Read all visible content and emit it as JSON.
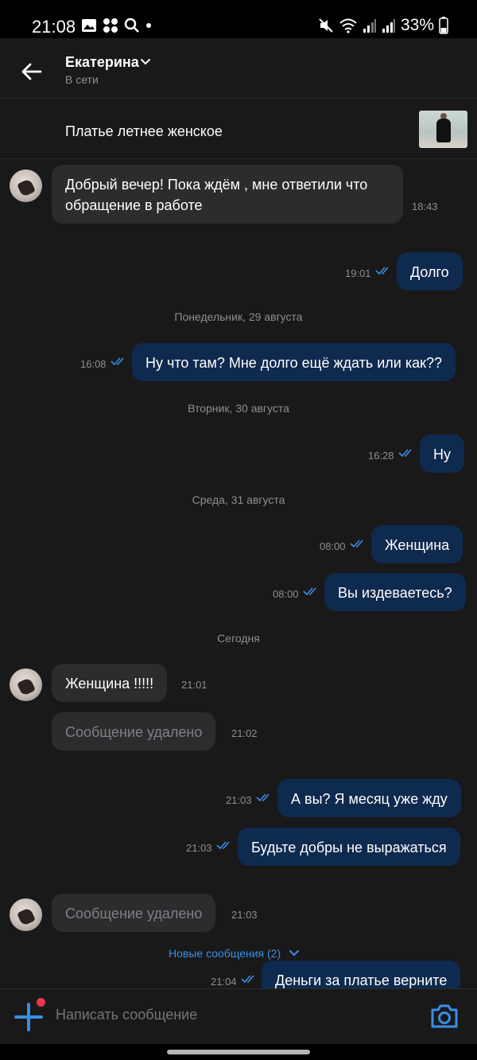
{
  "status_bar": {
    "time": "21:08",
    "battery": "33%",
    "icons_left": [
      "gallery-icon",
      "apps-icon",
      "search-icon",
      "dot-icon"
    ],
    "icons_right": [
      "mute-icon",
      "wifi-icon",
      "signal-icon",
      "signal-icon",
      "battery-icon"
    ]
  },
  "header": {
    "name": "Екатерина",
    "status": "В сети"
  },
  "product": {
    "title": "Платье летнее женское"
  },
  "messages": [
    {
      "dir": "in",
      "lines": [
        "Добрый вечер! Пока ждём , мне ответили что",
        "обращение в работе"
      ],
      "time": "18:43"
    },
    {
      "dir": "out",
      "text": "Долго",
      "time": "19:01"
    },
    {
      "separator": "Понедельник, 29 августа"
    },
    {
      "dir": "out",
      "text": "Ну что там? Мне долго ещё ждать или как??",
      "time": "16:08"
    },
    {
      "separator": "Вторник, 30 августа"
    },
    {
      "dir": "out",
      "text": "Ну",
      "time": "16:28"
    },
    {
      "separator": "Среда, 31 августа"
    },
    {
      "dir": "out",
      "text": "Женщина",
      "time": "08:00"
    },
    {
      "dir": "out",
      "text": "Вы издеваетесь?",
      "time": "08:00"
    },
    {
      "separator": "Сегодня"
    },
    {
      "dir": "in",
      "text": "Женщина !!!!!",
      "time": "21:01"
    },
    {
      "dir": "in",
      "deleted": true,
      "text": "Сообщение удалено",
      "time": "21:02"
    },
    {
      "dir": "out",
      "text": "А вы? Я месяц уже жду",
      "time": "21:03"
    },
    {
      "dir": "out",
      "text": "Будьте добры не выражаться",
      "time": "21:03"
    },
    {
      "dir": "in",
      "deleted": true,
      "text": "Сообщение удалено",
      "time": "21:03"
    },
    {
      "dir": "out",
      "text": "Деньги за платье верните",
      "time": "21:04"
    }
  ],
  "new_messages": "Новые сообщения (2)",
  "composer": {
    "placeholder": "Написать сообщение"
  },
  "colors": {
    "background": "#19191a",
    "incoming_bubble": "#2c2c2e",
    "outgoing_bubble": "#0f2a4f",
    "accent": "#3a8ee6",
    "badge": "#e6374a"
  }
}
